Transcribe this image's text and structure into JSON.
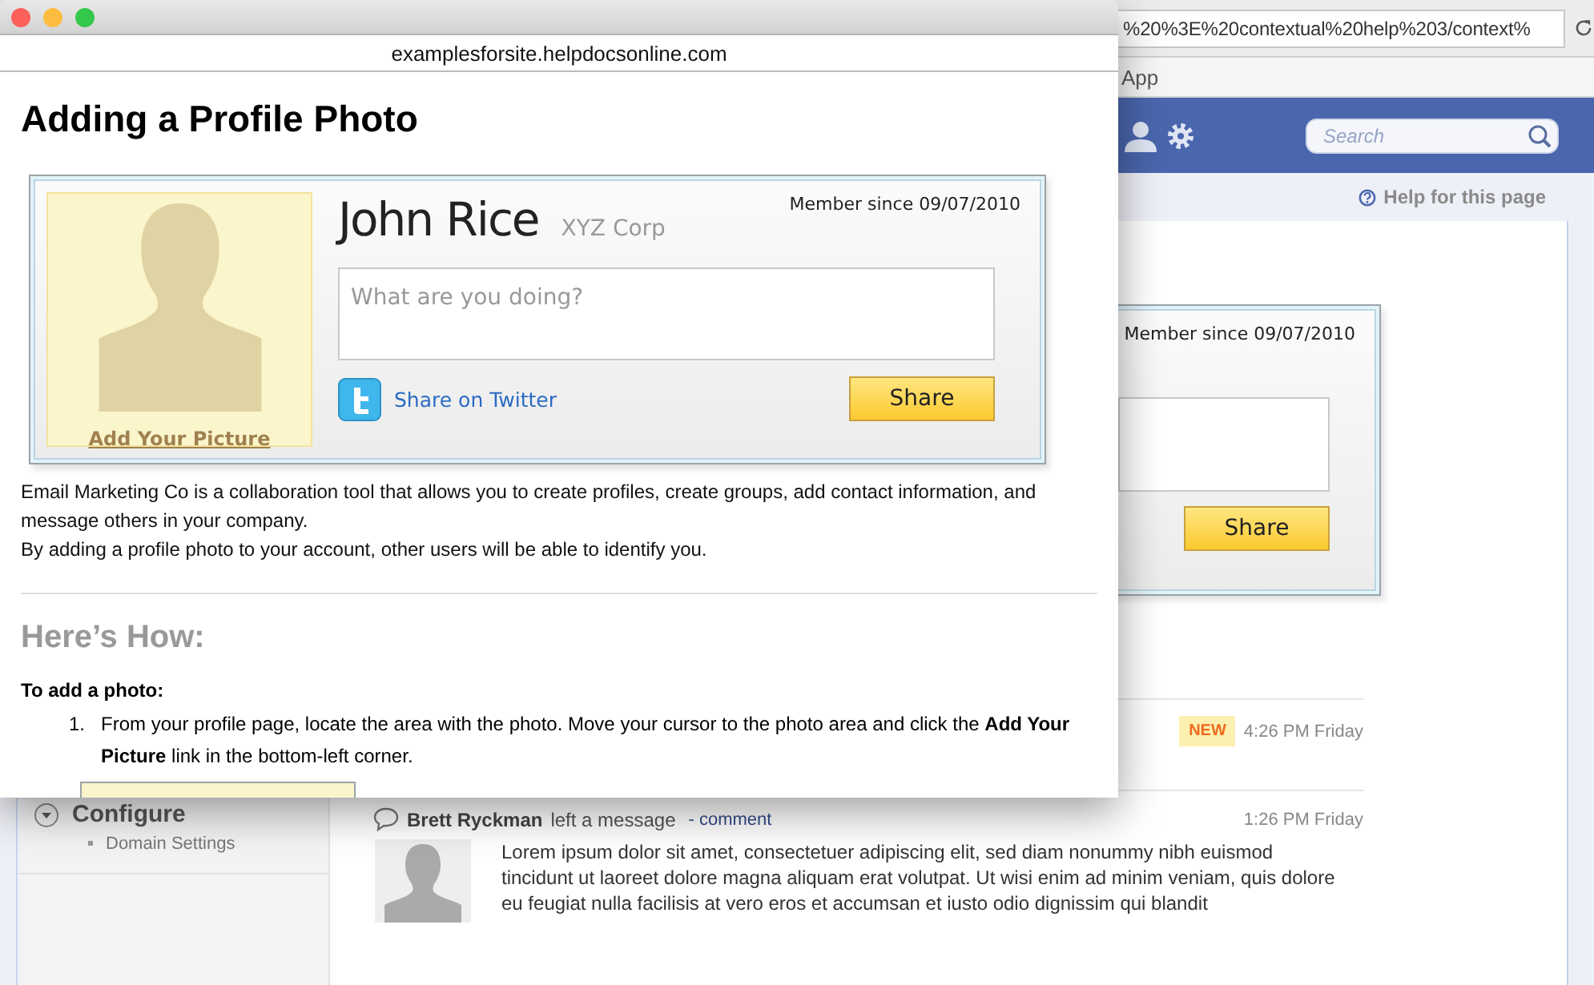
{
  "background_browser": {
    "address_bar": {
      "url": "%20%3E%20contextual%20help%203/context%"
    },
    "bookmarks": [
      "App"
    ],
    "header": {
      "search": {
        "placeholder": "Search"
      }
    },
    "help_link": "Help for this page",
    "sidebar": {
      "section": "Configure",
      "expanded": true,
      "items": [
        "Domain Settings"
      ]
    },
    "profile_card": {
      "member_since": "Member since 09/07/2010",
      "share_button": "Share"
    },
    "feed": [
      {
        "kind": "event",
        "badge": "NEW",
        "time": "4:26 PM Friday"
      },
      {
        "kind": "message",
        "author": "Brett Ryckman",
        "action": "left a message",
        "link": "- comment",
        "time": "1:26 PM Friday",
        "body": "Lorem ipsum dolor sit amet, consectetuer adipiscing elit, sed diam nonummy nibh euismod tincidunt ut laoreet dolore magna aliquam erat volutpat. Ut wisi enim ad minim veniam, quis dolore eu feugiat nulla facilisis at vero eros et accumsan et iusto odio dignissim qui blandit"
      }
    ]
  },
  "help_window": {
    "address": "examplesforsite.helpdocsonline.com",
    "title": "Adding a Profile Photo",
    "profile_card": {
      "name": "John Rice",
      "company": "XYZ Corp",
      "member_since": "Member since 09/07/2010",
      "status": {
        "placeholder": "What are you doing?"
      },
      "photo_link": "Add Your Picture",
      "twitter_link": "Share on Twitter",
      "share_button": "Share"
    },
    "intro": [
      "Email Marketing Co is a collaboration tool that allows you to create profiles, create groups, add contact information, and message others in your company.",
      "By adding a profile photo to your account, other users will be able to identify you."
    ],
    "section_title": "Here’s How:",
    "subheading": "To add a photo:",
    "steps": [
      {
        "number": "1.",
        "text": "From your profile page, locate the area with the photo. Move your cursor to the photo area and click the **Add Your Picture** link in the bottom-left corner."
      }
    ]
  }
}
